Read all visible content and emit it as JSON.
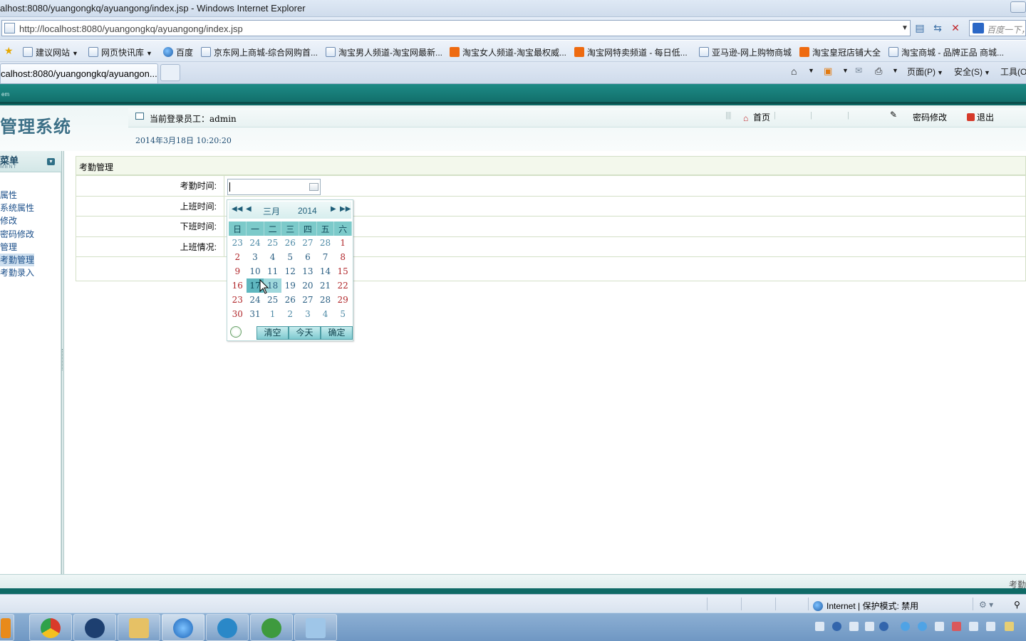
{
  "browser": {
    "window_title": "alhost:8080/yuangongkq/ayuangong/index.jsp - Windows Internet Explorer",
    "address_url": "http://localhost:8080/yuangongkq/ayuangong/index.jsp",
    "search_placeholder": "百度一下，",
    "tab_title": "calhost:8080/yuangongkq/ayuangon...",
    "favorites": [
      {
        "label": "建议网站",
        "icon": "ie-page-icon",
        "dropdown": true
      },
      {
        "label": "网页快讯库",
        "icon": "ie-page-icon",
        "dropdown": true
      },
      {
        "label": "百度",
        "icon": "globe-icon"
      },
      {
        "label": "京东网上商城-综合网购首...",
        "icon": "ie-page-icon"
      },
      {
        "label": "淘宝男人频道-淘宝网最新...",
        "icon": "ie-page-icon"
      },
      {
        "label": "淘宝女人频道-淘宝最权威...",
        "icon": "taobao-icon"
      },
      {
        "label": "淘宝网特卖频道 - 每日低...",
        "icon": "taobao-icon"
      },
      {
        "label": "亚马逊-网上购物商城",
        "icon": "ie-page-icon"
      },
      {
        "label": "淘宝皇冠店铺大全",
        "icon": "taobao-icon"
      },
      {
        "label": "淘宝商城 - 品牌正品 商城...",
        "icon": "ie-page-icon"
      }
    ],
    "commands": {
      "page": "页面(P)",
      "safety": "安全(S)",
      "tools": "工具(O"
    },
    "status_zone": "Internet | 保护模式: 禁用"
  },
  "app": {
    "brand_en": "em",
    "system_title": "管理系统",
    "current_user_label": "当前登录员工：admin",
    "datetime": "2014年3月18日  10:20:20",
    "nav": {
      "home": "首页",
      "change_password": "密码修改",
      "logout": "退出"
    },
    "menu": {
      "title": "菜单",
      "subtitle": "MENT",
      "items": [
        {
          "label": "属性",
          "active": false
        },
        {
          "label": "系统属性",
          "active": false
        },
        {
          "label": "修改",
          "active": false
        },
        {
          "label": "密码修改",
          "active": false
        },
        {
          "label": "管理",
          "active": false
        },
        {
          "label": "考勤管理",
          "active": true
        },
        {
          "label": "考勤录入",
          "active": false
        }
      ]
    },
    "panel_title": "考勤管理",
    "form": {
      "attendance_time_label": "考勤时间:",
      "attendance_time_value": "",
      "start_time_label": "上班时间:",
      "end_time_label": "下班时间:",
      "status_label": "上班情况:"
    },
    "status_right": "考勤"
  },
  "calendar": {
    "month": "三月",
    "year": "2014",
    "weekdays": [
      "日",
      "一",
      "二",
      "三",
      "四",
      "五",
      "六"
    ],
    "weeks": [
      [
        "23",
        "24",
        "25",
        "26",
        "27",
        "28",
        "1"
      ],
      [
        "2",
        "3",
        "4",
        "5",
        "6",
        "7",
        "8"
      ],
      [
        "9",
        "10",
        "11",
        "12",
        "13",
        "14",
        "15"
      ],
      [
        "16",
        "17",
        "18",
        "19",
        "20",
        "21",
        "22"
      ],
      [
        "23",
        "24",
        "25",
        "26",
        "27",
        "28",
        "29"
      ],
      [
        "30",
        "31",
        "1",
        "2",
        "3",
        "4",
        "5"
      ]
    ],
    "other_month_cells": [
      [
        0,
        0
      ],
      [
        0,
        1
      ],
      [
        0,
        2
      ],
      [
        0,
        3
      ],
      [
        0,
        4
      ],
      [
        0,
        5
      ],
      [
        5,
        2
      ],
      [
        5,
        3
      ],
      [
        5,
        4
      ],
      [
        5,
        5
      ],
      [
        5,
        6
      ]
    ],
    "today_cell": [
      3,
      1
    ],
    "hover_cell": [
      3,
      2
    ],
    "buttons": {
      "clear": "清空",
      "today": "今天",
      "ok": "确定"
    }
  },
  "colors": {
    "app_teal": "#0f6a66",
    "calendar_header": "#7ccaca",
    "weekend_red": "#b0262a",
    "menu_link": "#1b4f8a"
  }
}
